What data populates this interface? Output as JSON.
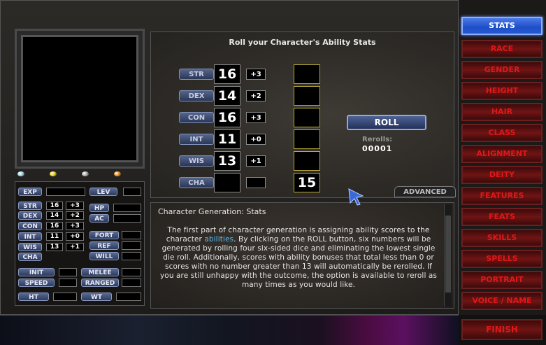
{
  "roll_panel": {
    "title": "Roll your Character's Ability Stats",
    "abilities": [
      {
        "name": "STR",
        "score": "16",
        "mod": "+3",
        "slot": ""
      },
      {
        "name": "DEX",
        "score": "14",
        "mod": "+2",
        "slot": ""
      },
      {
        "name": "CON",
        "score": "16",
        "mod": "+3",
        "slot": ""
      },
      {
        "name": "INT",
        "score": "11",
        "mod": "+0",
        "slot": ""
      },
      {
        "name": "WIS",
        "score": "13",
        "mod": "+1",
        "slot": ""
      },
      {
        "name": "CHA",
        "score": "",
        "mod": "",
        "slot": "15"
      }
    ],
    "roll_label": "ROLL",
    "rerolls_label": "Rerolls:",
    "rerolls_value": "00001",
    "advanced_label": "ADVANCED"
  },
  "help": {
    "title": "Character Generation: Stats",
    "text_before_link": "The first part of character generation is assigning ability scores to the character ",
    "link": "abilities",
    "text_after_link": ". By clicking on the ROLL button, six numbers will be generated by rolling four six-sided dice and eliminating the lowest single die roll. Additionally, scores with ability bonuses that total less than 0 or scores with no number greater than 13 will automatically be rerolled. If you are still unhappy with the outcome, the option is available to reroll as many times as you would like."
  },
  "stat_panel": {
    "exp_label": "EXP",
    "lev_label": "LEV",
    "rows": [
      {
        "name": "STR",
        "score": "16",
        "mod": "+3"
      },
      {
        "name": "DEX",
        "score": "14",
        "mod": "+2"
      },
      {
        "name": "CON",
        "score": "16",
        "mod": "+3"
      },
      {
        "name": "INT",
        "score": "11",
        "mod": "+0"
      },
      {
        "name": "WIS",
        "score": "13",
        "mod": "+1"
      },
      {
        "name": "CHA",
        "score": "",
        "mod": ""
      }
    ],
    "hp_label": "HP",
    "ac_label": "AC",
    "fort_label": "FORT",
    "ref_label": "REF",
    "will_label": "WILL",
    "init_label": "INIT",
    "melee_label": "MELEE",
    "speed_label": "SPEED",
    "ranged_label": "RANGED",
    "ht_label": "HT",
    "wt_label": "WT"
  },
  "gems": [
    {
      "name": "white-gem-icon",
      "color": "#a8d8e8"
    },
    {
      "name": "yellow-gem-icon",
      "color": "#e8d020"
    },
    {
      "name": "gray-gem-icon",
      "color": "#b0b0b0"
    },
    {
      "name": "orange-gem-icon",
      "color": "#f09020"
    }
  ],
  "sidebar": {
    "items": [
      {
        "label": "STATS",
        "active": true
      },
      {
        "label": "RACE",
        "active": false
      },
      {
        "label": "GENDER",
        "active": false
      },
      {
        "label": "HEIGHT",
        "active": false
      },
      {
        "label": "HAIR",
        "active": false
      },
      {
        "label": "CLASS",
        "active": false
      },
      {
        "label": "ALIGNMENT",
        "active": false
      },
      {
        "label": "DEITY",
        "active": false
      },
      {
        "label": "FEATURES",
        "active": false
      },
      {
        "label": "FEATS",
        "active": false
      },
      {
        "label": "SKILLS",
        "active": false
      },
      {
        "label": "SPELLS",
        "active": false
      },
      {
        "label": "PORTRAIT",
        "active": false
      },
      {
        "label": "VOICE / NAME",
        "active": false
      }
    ],
    "finish_label": "FINISH"
  },
  "colors": {
    "accent_blue": "#2458d0",
    "nav_red": "#e01818",
    "slot_border": "#b8a838",
    "link": "#58b8f0"
  }
}
